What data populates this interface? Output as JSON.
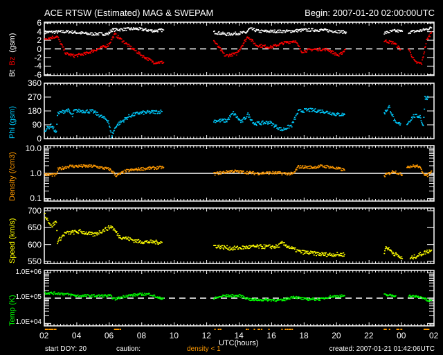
{
  "header": {
    "title": "ACE RTSW (Estimated) MAG & SWEPAM",
    "begin": "Begin: 2007-01-20 02:00:00UTC"
  },
  "footer": {
    "start_doy": "start DOY:  20",
    "caution": "caution:",
    "density_caution": "density < 1",
    "created": "created: 2007-01-21 01:42:06UTC"
  },
  "colors": {
    "bt": "#ffffff",
    "bz": "#ff0000",
    "phi": "#00ccff",
    "density": "#ff9900",
    "speed": "#ffff00",
    "temp": "#00ff00"
  },
  "chart_data": [
    {
      "type": "scatter",
      "id": "mag",
      "ylabel_parts": [
        "Bt",
        "Bz",
        "(gsm)"
      ],
      "ylim": [
        -6.2,
        6.2
      ],
      "scale": "linear",
      "ticks": [
        -6,
        -4,
        -2,
        0,
        2,
        4,
        6
      ],
      "tick_labels": [
        "-6",
        "-4",
        "-2",
        "0",
        "2",
        "4",
        "6"
      ],
      "reference": {
        "value": 0,
        "style": "dashed"
      },
      "series": [
        {
          "name": "Bt",
          "color": "#ffffff",
          "segments": [
            [
              [
                0,
                4
              ],
              [
                1.5,
                4.1
              ],
              [
                2.7,
                3.6
              ],
              [
                3.9,
                3.6
              ],
              [
                4.1,
                4.5
              ],
              [
                5.6,
                4.8
              ],
              [
                6.7,
                4.3
              ],
              [
                7.3,
                4.5
              ]
            ],
            [
              [
                10.4,
                4
              ],
              [
                11.2,
                3.5
              ],
              [
                12.4,
                3.9
              ],
              [
                12.6,
                4.8
              ],
              [
                13.2,
                4.2
              ],
              [
                15,
                4.2
              ],
              [
                16,
                4.5
              ],
              [
                17,
                4.5
              ],
              [
                18.55,
                4.0
              ]
            ],
            [
              [
                20.9,
                3.8
              ],
              [
                21.5,
                4.3
              ],
              [
                22,
                4.2
              ]
            ],
            [
              [
                22.4,
                4.0
              ],
              [
                23.2,
                4.4
              ],
              [
                23.8,
                5.0
              ]
            ]
          ]
        },
        {
          "name": "Bz",
          "color": "#ff0000",
          "segments": [
            [
              [
                0,
                2.5
              ],
              [
                0.75,
                3
              ],
              [
                1.3,
                -1
              ],
              [
                1.8,
                -1.5
              ],
              [
                2.5,
                -1
              ],
              [
                3.2,
                0
              ],
              [
                3.9,
                1
              ],
              [
                4.3,
                3.5
              ],
              [
                5.1,
                1
              ],
              [
                6,
                -1.5
              ],
              [
                6.7,
                -3
              ],
              [
                7.3,
                -3
              ]
            ],
            [
              [
                10.4,
                2
              ],
              [
                11.1,
                -1.5
              ],
              [
                11.8,
                -1
              ],
              [
                12.5,
                3
              ],
              [
                13,
                1
              ],
              [
                13.9,
                0.5
              ],
              [
                14.7,
                1.5
              ],
              [
                15.4,
                2
              ],
              [
                15.8,
                -0.5
              ],
              [
                16.5,
                0
              ],
              [
                17.4,
                0
              ],
              [
                18.1,
                -1.5
              ],
              [
                18.5,
                0
              ]
            ],
            [
              [
                20.9,
                2
              ],
              [
                21.5,
                1.5
              ],
              [
                21.9,
                0
              ]
            ],
            [
              [
                22.4,
                0
              ],
              [
                22.8,
                -3
              ],
              [
                23.2,
                -3.3
              ],
              [
                23.5,
                2
              ],
              [
                23.8,
                4
              ]
            ]
          ]
        }
      ]
    },
    {
      "type": "scatter",
      "id": "phi",
      "ylabel": "Phi (gsm)",
      "ylim": [
        0,
        360
      ],
      "scale": "linear",
      "ticks": [
        0,
        90,
        180,
        270,
        360
      ],
      "tick_labels": [
        "0",
        "90",
        "180",
        "270",
        "360"
      ],
      "series": [
        {
          "name": "Phi",
          "color": "#00ccff",
          "segments": [
            [
              [
                0,
                60
              ],
              [
                0.4,
                90
              ],
              [
                0.7,
                40
              ],
              [
                0.77,
                165
              ],
              [
                1.4,
                190
              ],
              [
                1.7,
                150
              ],
              [
                1.8,
                185
              ],
              [
                2.95,
                180
              ],
              [
                3.9,
                120
              ],
              [
                4.1,
                20
              ],
              [
                4.4,
                90
              ],
              [
                5.2,
                150
              ],
              [
                5.8,
                170
              ],
              [
                7.2,
                180
              ]
            ],
            [
              [
                10.4,
                120
              ],
              [
                11.2,
                120
              ],
              [
                11.6,
                170
              ],
              [
                12.1,
                110
              ],
              [
                12.5,
                160
              ],
              [
                12.9,
                100
              ],
              [
                13.8,
                110
              ],
              [
                14.6,
                60
              ],
              [
                15.2,
                90
              ],
              [
                15.6,
                180
              ],
              [
                16.2,
                190
              ],
              [
                17.2,
                180
              ],
              [
                18,
                160
              ],
              [
                18.45,
                160
              ]
            ],
            [
              [
                20.9,
                170
              ],
              [
                21.2,
                210
              ],
              [
                21.6,
                100
              ],
              [
                21.9,
                100
              ]
            ],
            [
              [
                22.3,
                100
              ],
              [
                22.7,
                150
              ],
              [
                23.1,
                150
              ],
              [
                23.3,
                80
              ],
              [
                23.4,
                270
              ],
              [
                23.6,
                270
              ]
            ]
          ]
        }
      ]
    },
    {
      "type": "scatter",
      "id": "density",
      "ylabel": "Density (/cm3)",
      "ylim": [
        0.08,
        12.5
      ],
      "scale": "log",
      "ticks": [
        0.1,
        1,
        10
      ],
      "tick_labels": [
        "0.1",
        "1.0",
        "10.0"
      ],
      "reference": {
        "value": 1,
        "style": "solid"
      },
      "series": [
        {
          "name": "Density",
          "color": "#ff9900",
          "segments": [
            [
              [
                0,
                0.95
              ],
              [
                0.7,
                0.9
              ],
              [
                0.8,
                1.5
              ],
              [
                1.5,
                2.0
              ],
              [
                3,
                2.0
              ],
              [
                4,
                1.5
              ],
              [
                4.4,
                0.85
              ],
              [
                5,
                1.3
              ],
              [
                6,
                1.6
              ],
              [
                7.3,
                1.8
              ]
            ],
            [
              [
                10.4,
                1.0
              ],
              [
                11.5,
                1.3
              ],
              [
                13,
                1.05
              ],
              [
                14,
                1.1
              ],
              [
                15.3,
                1.0
              ],
              [
                15.6,
                1.9
              ],
              [
                16.5,
                1.8
              ],
              [
                17,
                2.0
              ],
              [
                17.5,
                1.9
              ],
              [
                18.45,
                1.4
              ]
            ],
            [
              [
                20.9,
                0.85
              ],
              [
                21.5,
                1.3
              ],
              [
                22,
                0.9
              ]
            ],
            [
              [
                22.3,
                2.0
              ],
              [
                23,
                2.0
              ],
              [
                23.5,
                0.8
              ],
              [
                23.8,
                1.3
              ]
            ]
          ]
        }
      ],
      "caution_threshold": 1
    },
    {
      "type": "scatter",
      "id": "speed",
      "ylabel": "Speed (km/s)",
      "ylim": [
        544,
        708
      ],
      "scale": "linear",
      "ticks": [
        550,
        600,
        650,
        700
      ],
      "tick_labels": [
        "550",
        "600",
        "650",
        "700"
      ],
      "series": [
        {
          "name": "Speed",
          "color": "#ffff00",
          "segments": [
            [
              [
                0,
                690
              ],
              [
                0.4,
                655
              ],
              [
                0.7,
                670
              ],
              [
                0.77,
                610
              ],
              [
                1.25,
                635
              ],
              [
                2.2,
                640
              ],
              [
                3,
                630
              ],
              [
                4.1,
                655
              ],
              [
                4.6,
                625
              ],
              [
                5.8,
                610
              ],
              [
                7.2,
                608
              ]
            ],
            [
              [
                10.4,
                598
              ],
              [
                11.5,
                590
              ],
              [
                12.9,
                595
              ],
              [
                14.3,
                595
              ],
              [
                14.6,
                605
              ],
              [
                15.2,
                590
              ],
              [
                15.7,
                580
              ],
              [
                17.2,
                572
              ],
              [
                18.45,
                572
              ]
            ],
            [
              [
                20.9,
                575
              ],
              [
                21,
                595
              ],
              [
                21.5,
                575
              ],
              [
                22,
                560
              ]
            ],
            [
              [
                22.5,
                560
              ],
              [
                23,
                570
              ],
              [
                23.5,
                580
              ],
              [
                23.8,
                585
              ]
            ]
          ]
        }
      ]
    },
    {
      "type": "scatter",
      "id": "temp",
      "ylabel": "Temp (K)",
      "ylim": [
        7943,
        1258925
      ],
      "scale": "log",
      "ticks": [
        10000,
        100000,
        1000000
      ],
      "tick_labels": [
        "1.0E+04",
        "1.0E+05",
        "1.0E+06"
      ],
      "reference": {
        "value": 100000,
        "style": "dashed"
      },
      "series": [
        {
          "name": "Temp",
          "color": "#00ff00",
          "segments": [
            [
              [
                0,
                170000
              ],
              [
                1,
                160000
              ],
              [
                2,
                130000
              ],
              [
                4,
                130000
              ],
              [
                4.3,
                95000
              ],
              [
                5,
                130000
              ],
              [
                6,
                150000
              ],
              [
                6.5,
                150000
              ],
              [
                7,
                105000
              ],
              [
                7.3,
                105000
              ]
            ],
            [
              [
                10.4,
                100000
              ],
              [
                11,
                130000
              ],
              [
                12,
                130000
              ],
              [
                12.7,
                90000
              ],
              [
                14,
                90000
              ],
              [
                14.6,
                85000
              ],
              [
                15.3,
                120000
              ],
              [
                16,
                95000
              ],
              [
                17,
                95000
              ],
              [
                17.5,
                120000
              ],
              [
                18.45,
                130000
              ]
            ],
            [
              [
                20.9,
                140000
              ],
              [
                21.6,
                130000
              ]
            ],
            [
              [
                22.4,
                130000
              ],
              [
                23.3,
                110000
              ],
              [
                23.6,
                80000
              ],
              [
                23.8,
                85000
              ]
            ]
          ]
        }
      ]
    }
  ],
  "xaxis": {
    "label": "UTC(hours)",
    "range_hours": [
      0,
      24
    ],
    "tick_labels": [
      "02",
      "04",
      "06",
      "08",
      "10",
      "12",
      "14",
      "16",
      "18",
      "20",
      "22",
      "00",
      "02"
    ]
  }
}
